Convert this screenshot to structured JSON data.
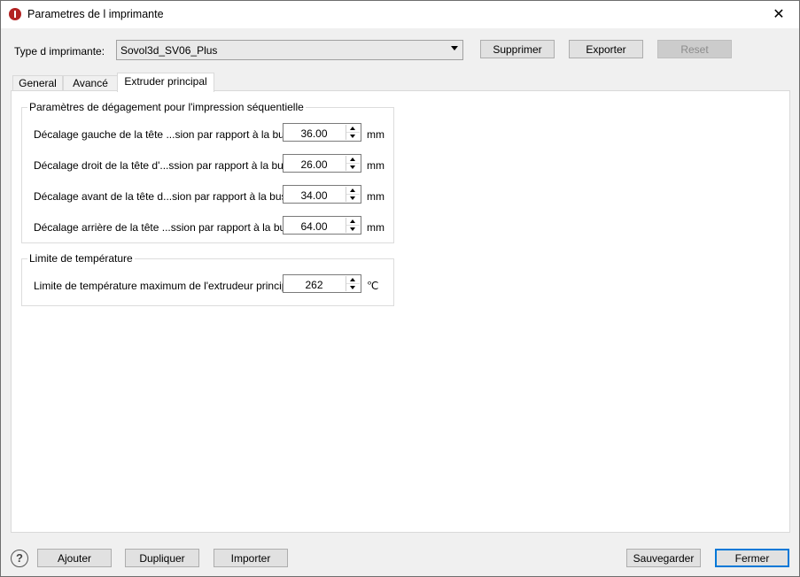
{
  "window": {
    "title": "Parametres de l imprimante",
    "icon": "printer-app-icon",
    "close_glyph": "✕"
  },
  "printer_type": {
    "label": "Type d imprimante:",
    "selected": "Sovol3d_SV06_Plus"
  },
  "top_buttons": {
    "delete": "Supprimer",
    "export": "Exporter",
    "reset": "Reset"
  },
  "tabs": [
    {
      "label": "General"
    },
    {
      "label": "Avancé"
    },
    {
      "label": "Extruder principal"
    }
  ],
  "clearance_group": {
    "title": "Paramètres de dégagement pour l'impression séquentielle",
    "rows": [
      {
        "label": "Décalage gauche de la tête ...sion par rapport à la buse:",
        "value": "36.00",
        "unit": "mm"
      },
      {
        "label": "Décalage droit de la tête d'...ssion par rapport à la buse:",
        "value": "26.00",
        "unit": "mm"
      },
      {
        "label": "Décalage avant de la tête d...sion par rapport à la buse:",
        "value": "34.00",
        "unit": "mm"
      },
      {
        "label": "Décalage arrière de la tête ...ssion par rapport à la buse:",
        "value": "64.00",
        "unit": "mm"
      }
    ]
  },
  "temperature_group": {
    "title": "Limite de température",
    "rows": [
      {
        "label": "Limite de température maximum de l'extrudeur principal:",
        "value": "262",
        "unit": "℃"
      }
    ]
  },
  "bottom_buttons": {
    "help": "?",
    "add": "Ajouter",
    "duplicate": "Dupliquer",
    "import": "Importer",
    "save": "Sauvegarder",
    "close": "Fermer"
  },
  "colors": {
    "accent": "#0078d7",
    "app_icon": "#b22222"
  }
}
